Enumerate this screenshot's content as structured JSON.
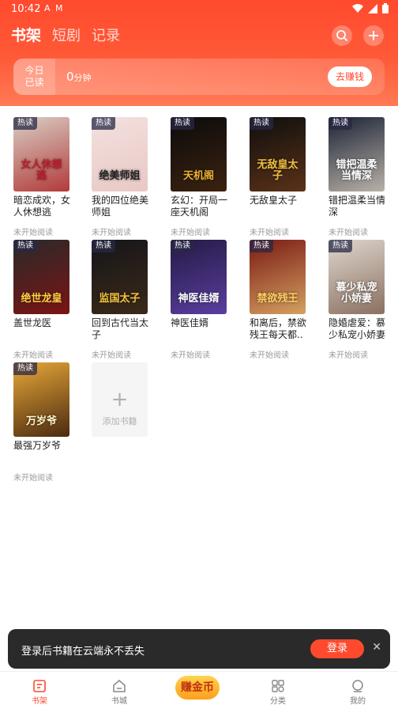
{
  "status_bar": {
    "time": "10:42",
    "left_icons": [
      "A",
      "M"
    ]
  },
  "tabs": [
    {
      "label": "书架",
      "active": true
    },
    {
      "label": "短剧",
      "active": false
    },
    {
      "label": "记录",
      "active": false
    }
  ],
  "today": {
    "label_line1": "今日",
    "label_line2": "已读",
    "minutes": "0",
    "unit": "分钟",
    "earn_label": "去赚钱"
  },
  "books": [
    {
      "title": "暗恋成欢，女人休想逃",
      "badge": "热读",
      "status": "未开始阅读",
      "cover_text": "女人休想逃",
      "colors": [
        "#d8cfc4",
        "#b23a3a"
      ],
      "text_color": "#c0182a"
    },
    {
      "title": "我的四位绝美师姐",
      "badge": "热读",
      "status": "未开始阅读",
      "cover_text": "绝美师姐",
      "colors": [
        "#f3e1df",
        "#e8c8c5"
      ],
      "text_color": "#222222"
    },
    {
      "title": "玄幻：开局一座天机阁",
      "badge": "热读",
      "status": "未开始阅读",
      "cover_text": "天机阁",
      "colors": [
        "#0b0b0b",
        "#3b2210"
      ],
      "text_color": "#e9b030"
    },
    {
      "title": "无敌皇太子",
      "badge": "热读",
      "status": "未开始阅读",
      "cover_text": "无敌皇太子",
      "colors": [
        "#0e0e0e",
        "#5a3218"
      ],
      "text_color": "#f0c040"
    },
    {
      "title": "错把温柔当情深",
      "badge": "热读",
      "status": "未开始阅读",
      "cover_text": "错把温柔当情深",
      "colors": [
        "#1c2335",
        "#b9b1a8"
      ],
      "text_color": "#ffffff"
    },
    {
      "title": "盖世龙医",
      "badge": "热读",
      "status": "未开始阅读",
      "cover_text": "绝世龙皇",
      "colors": [
        "#2a2a2a",
        "#7a1414"
      ],
      "text_color": "#ffd040"
    },
    {
      "title": "回到古代当太子",
      "badge": "热读",
      "status": "未开始阅读",
      "cover_text": "监国太子",
      "colors": [
        "#15151a",
        "#3b2a18"
      ],
      "text_color": "#f3c23a"
    },
    {
      "title": "神医佳婿",
      "badge": "热读",
      "status": "未开始阅读",
      "cover_text": "神医佳婿",
      "colors": [
        "#241a44",
        "#5a3ea0"
      ],
      "text_color": "#ffffff"
    },
    {
      "title": "和离后，禁欲残王每天都..",
      "badge": "热读",
      "status": "未开始阅读",
      "cover_text": "禁欲残王",
      "colors": [
        "#7a1a14",
        "#d4a060"
      ],
      "text_color": "#ffd060"
    },
    {
      "title": "隐婚虐爱：慕少私宠小娇妻",
      "badge": "热读",
      "status": "未开始阅读",
      "cover_text": "慕少私宠小娇妻",
      "colors": [
        "#dfd7cf",
        "#8a7060"
      ],
      "text_color": "#ffffff"
    },
    {
      "title": "最强万岁爷",
      "badge": "热读",
      "status": "未开始阅读",
      "cover_text": "万岁爷",
      "colors": [
        "#e8a838",
        "#4a2a10"
      ],
      "text_color": "#fff6d0"
    }
  ],
  "add_book_label": "添加书籍",
  "login_bar": {
    "message": "登录后书籍在云端永不丢失",
    "button": "登录"
  },
  "nav": {
    "bookshelf": "书架",
    "store": "书城",
    "earn": "赚金币",
    "category": "分类",
    "mine": "我的"
  },
  "accent_color": "#ff4a2e"
}
